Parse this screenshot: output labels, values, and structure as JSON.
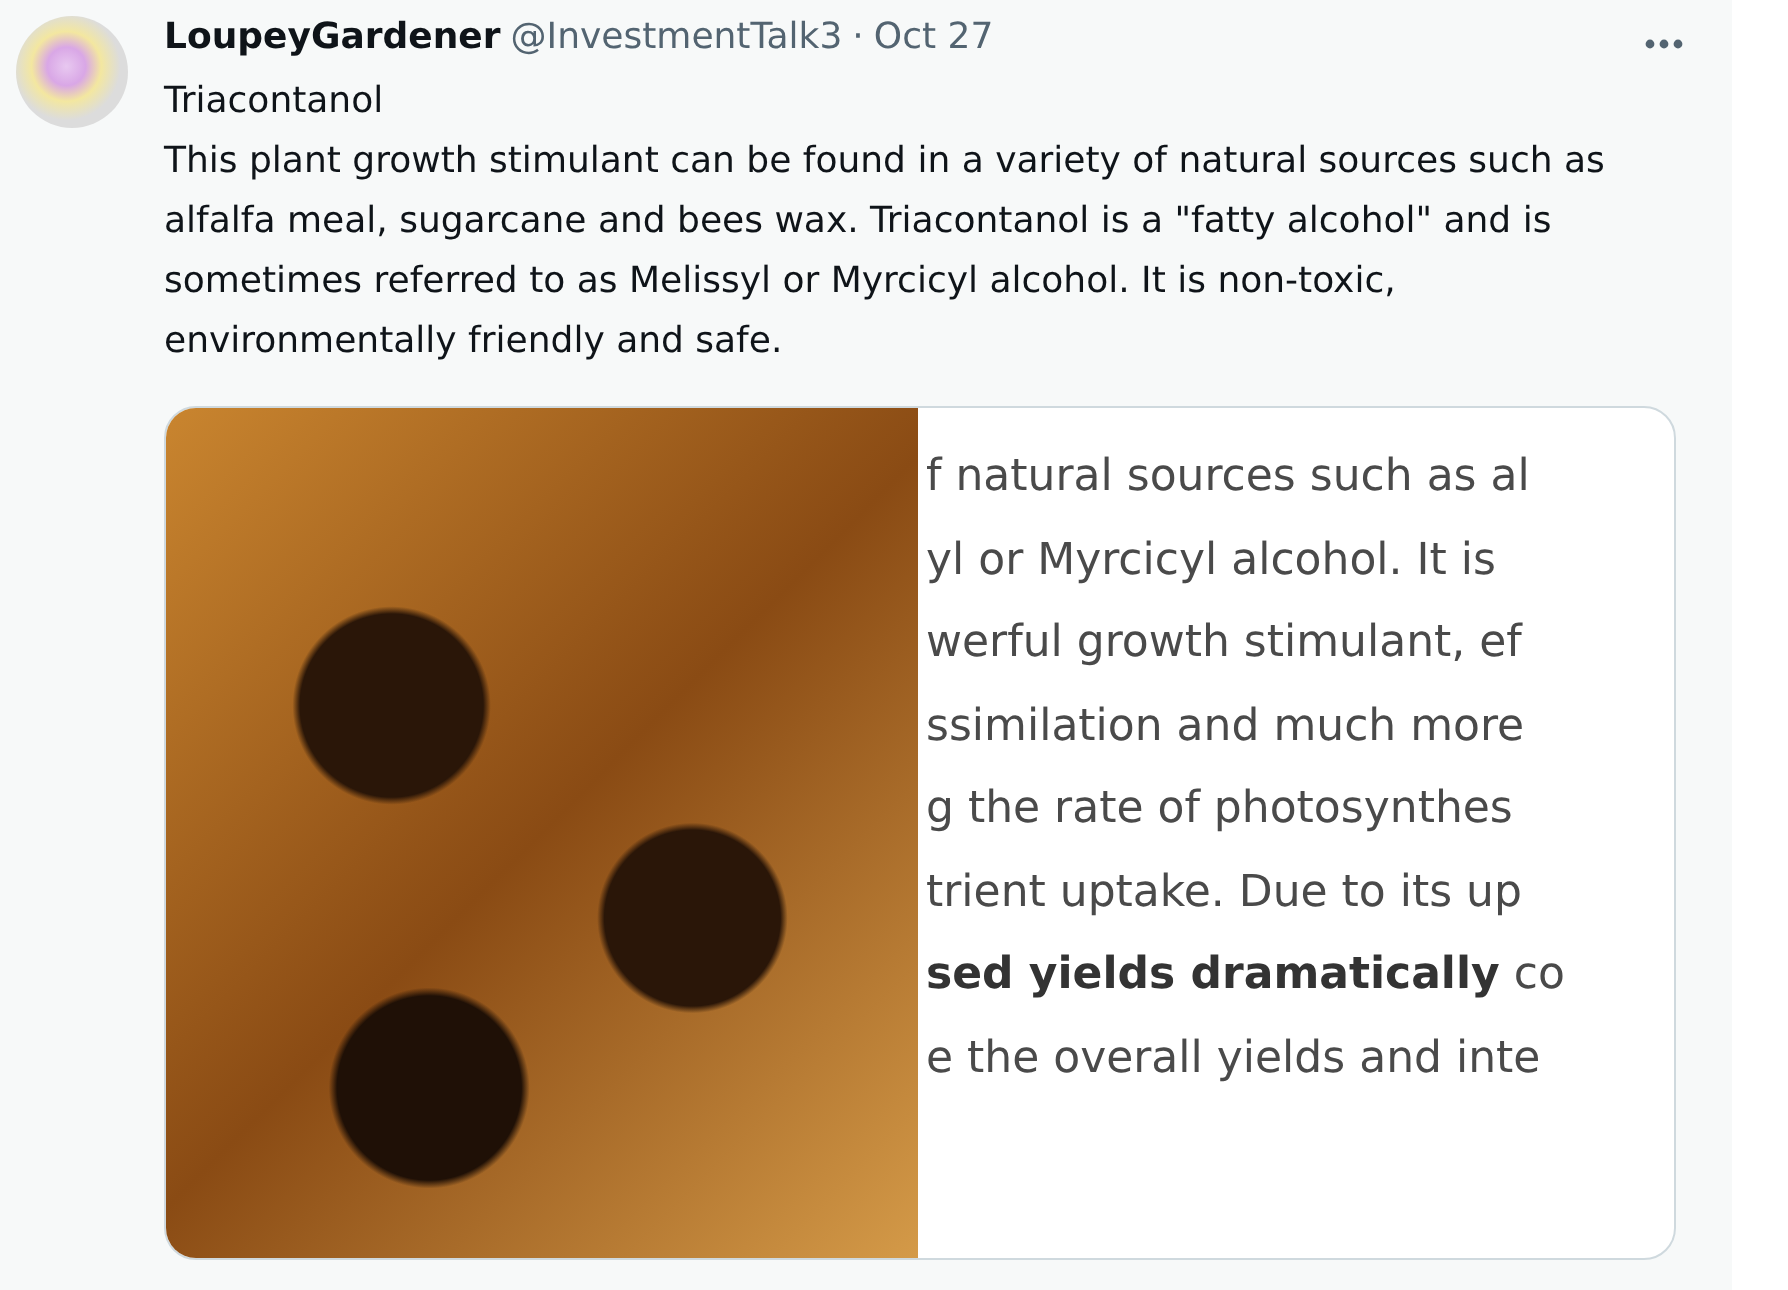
{
  "tweet": {
    "author": {
      "name": "LoupeyGardener",
      "handle": "@InvestmentTalk3",
      "separator": "·",
      "date": "Oct 27"
    },
    "text": [
      "Triacontanol",
      "This plant growth stimulant can be found in a variety of natural sources such as alfalfa meal, sugarcane and bees wax. Triacontanol is a \"fatty alcohol\" and is sometimes referred to as Melissyl or Myrcicyl alcohol. It is non-toxic, environmentally friendly and safe."
    ],
    "media": {
      "text_image_lines": [
        "f natural sources such as al",
        "yl or Myrcicyl alcohol. It is",
        "werful growth stimulant, ef",
        "ssimilation and much more",
        "g the rate of photosynthes",
        "trient uptake. Due to its up",
        "**sed yields dramatically** co",
        "e the overall yields and inte"
      ]
    }
  }
}
